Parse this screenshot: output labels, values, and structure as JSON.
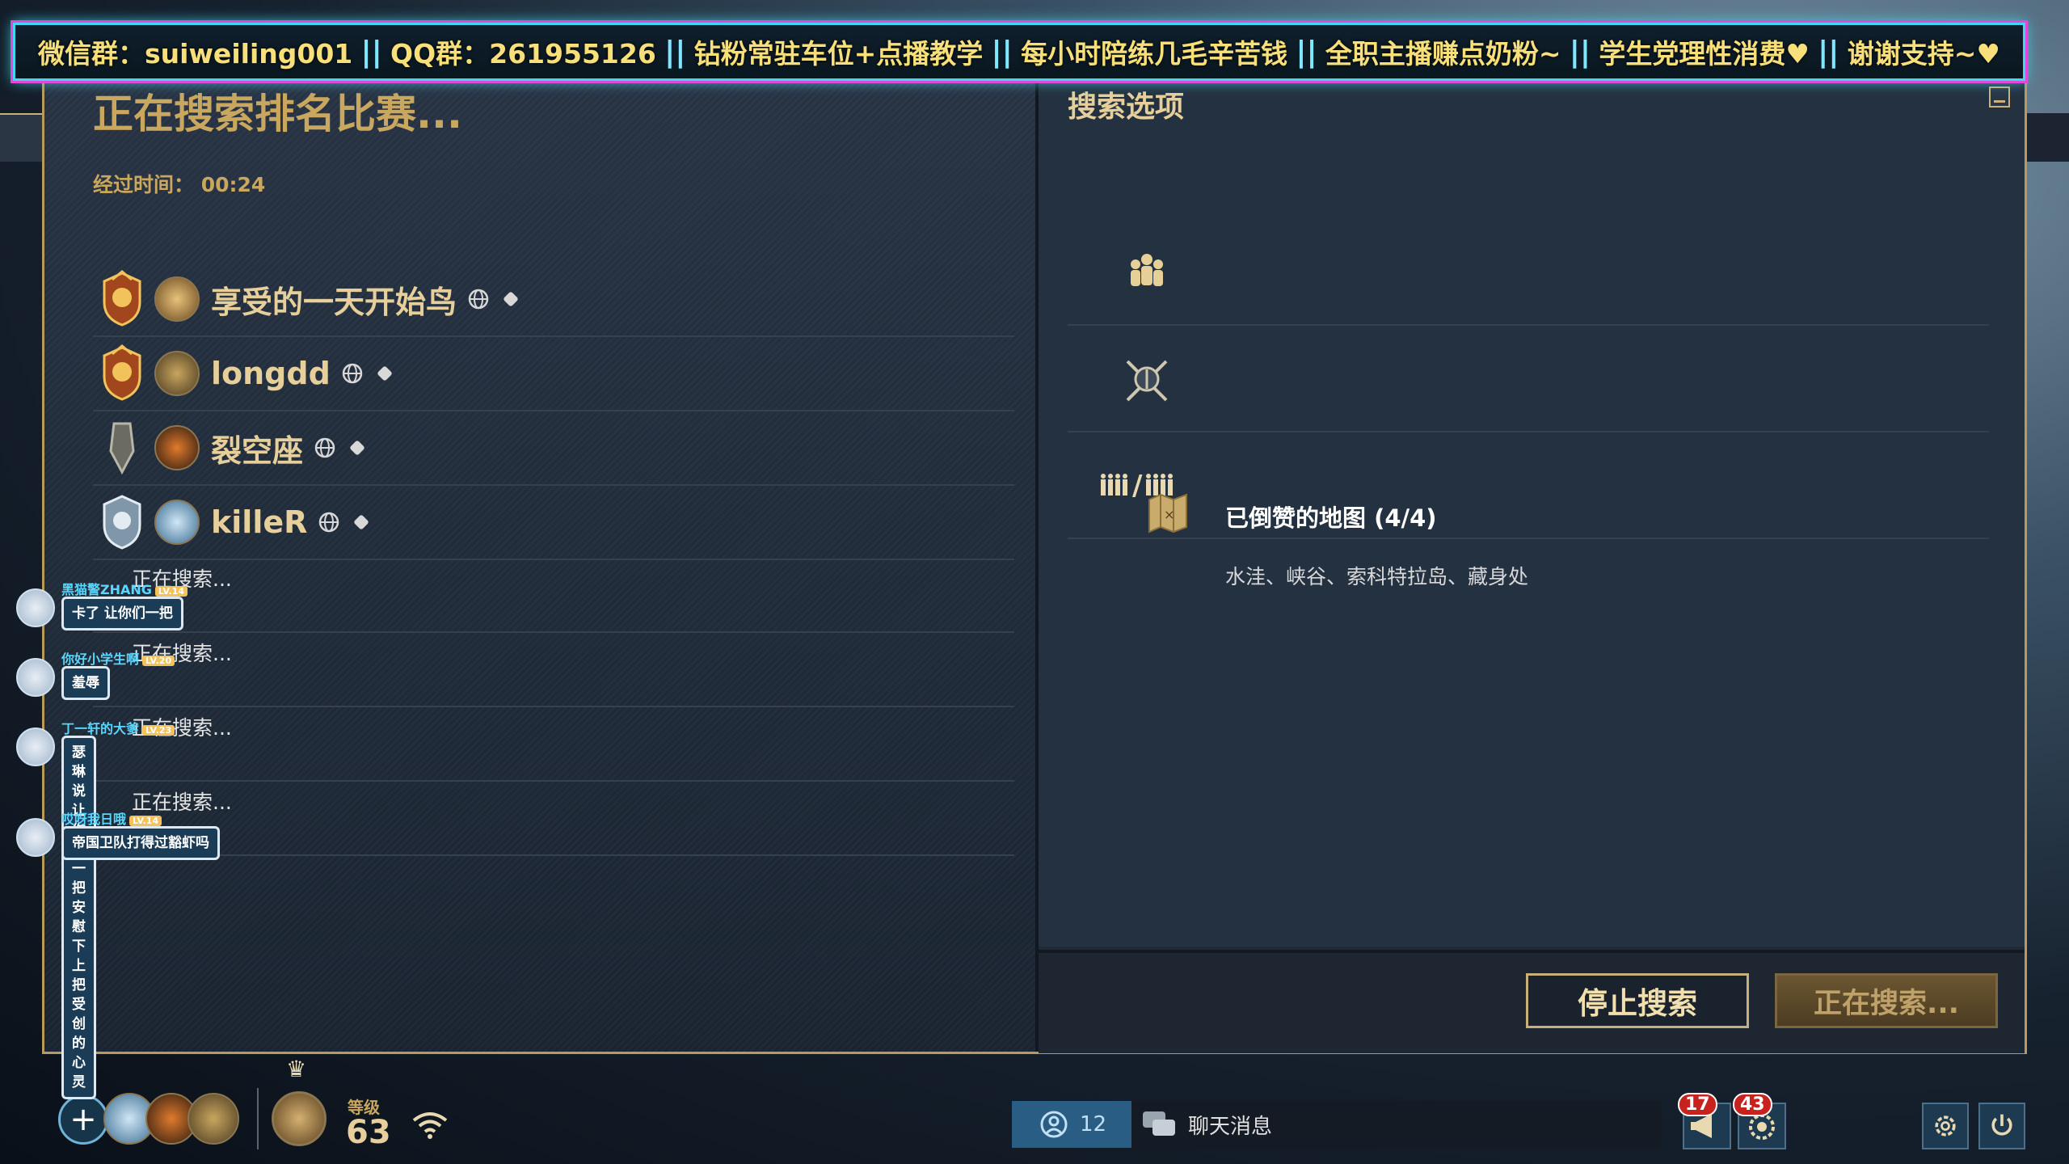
{
  "banner": {
    "items": [
      "微信群：suiweiling001",
      "QQ群：261955126",
      "钻粉常驻车位+点播教学",
      "每小时陪练几毛辛苦钱",
      "全职主播赚点奶粉~",
      "学生党理性消费♥",
      "谢谢支持~♥"
    ],
    "separator": "||"
  },
  "left": {
    "title": "正在搜索排名比赛...",
    "elapsed_label": "经过时间：",
    "elapsed_value": "00:24",
    "players": [
      {
        "name": "享受的一天开始鸟"
      },
      {
        "name": "longdd"
      },
      {
        "name": "裂空座"
      },
      {
        "name": "killeR"
      }
    ],
    "searching_label": "正在搜索..."
  },
  "chat_overlay": [
    {
      "user": "黑猫警ZHANG",
      "lv": "LV.14",
      "message": "卡了 让你们一把"
    },
    {
      "user": "你好小学生啊",
      "lv": "LV.20",
      "message": "羞辱"
    },
    {
      "user": "丁一轩的大爹",
      "lv": "LV.23",
      "message": "瑟琳说 让你们一把 安慰下\n上把受创的心灵"
    },
    {
      "user": "哎呀我日哦",
      "lv": "LV.14",
      "message": "帝国卫队打得过豁虾吗"
    }
  ],
  "right": {
    "title": "搜索选项",
    "ratio_label": "/",
    "maps_title": "已倒赞的地图 (4/4)",
    "maps_list": "水洼、峡谷、索科特拉岛、藏身处"
  },
  "buttons": {
    "stop": "停止搜索",
    "searching": "正在搜索..."
  },
  "bottom": {
    "level_label": "等级",
    "level_value": "63",
    "friends_count": "12",
    "chat_label": "聊天消息",
    "notif_1": "17",
    "notif_2": "43"
  },
  "colors": {
    "accent_gold": "#c9a75f",
    "banner_border": "#3fd8f0",
    "banner_glow": "#e048d8"
  }
}
